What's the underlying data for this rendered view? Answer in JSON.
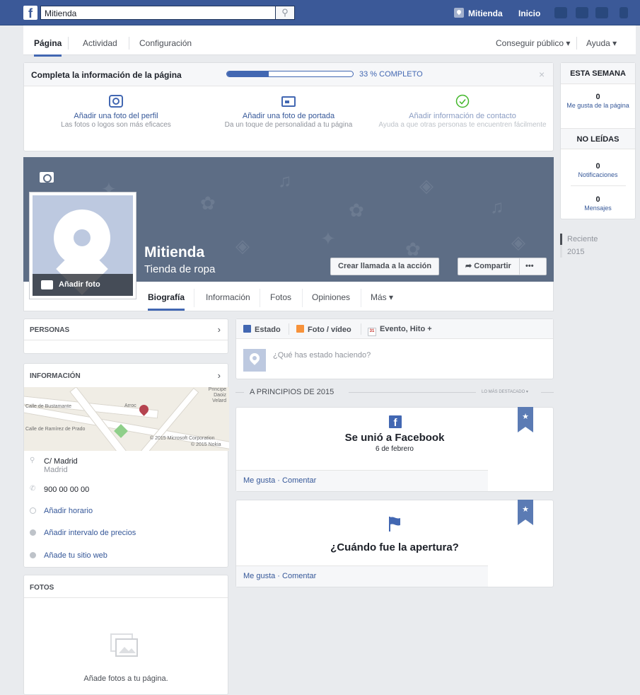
{
  "topbar": {
    "search_value": "Mitienda",
    "search_icon": "magnifier-icon",
    "profile_name": "Mitienda",
    "home_label": "Inicio"
  },
  "page_tabs": {
    "pagina": "Página",
    "actividad": "Actividad",
    "configuracion": "Configuración",
    "publico": "Conseguir público ▾",
    "ayuda": "Ayuda ▾"
  },
  "completion": {
    "title": "Completa la información de la página",
    "progress_pct": 33,
    "progress_label": "33 % COMPLETO",
    "close": "×",
    "steps": [
      {
        "title": "Añadir una foto del perfil",
        "subtitle": "Las fotos o logos son más eficaces"
      },
      {
        "title": "Añadir una foto de portada",
        "subtitle": "Da un toque de personalidad a tu página"
      },
      {
        "title": "Añadir información de contacto",
        "subtitle": "Ayuda a que otras personas te encuentren fácilmente"
      }
    ]
  },
  "cover": {
    "page_name": "Mitienda",
    "category": "Tienda de ropa",
    "add_photo": "Añadir foto",
    "cta_button": "Crear llamada a la acción",
    "share_button": "Compartir",
    "more_button": "•••"
  },
  "timeline_tabs": {
    "biografia": "Biografía",
    "informacion": "Información",
    "fotos": "Fotos",
    "opiniones": "Opiniones",
    "mas": "Más ▾"
  },
  "left": {
    "personas": "PERSONAS",
    "informacion": "INFORMACIÓN",
    "map": {
      "street1": "Calle de Bustamante",
      "street2": "Calle de Ramírez de Prado",
      "poi": "Arroc",
      "corner": "Principe\nDaoiz\nVelard",
      "copyright1": "© 2015 Microsoft Corporation",
      "copyright2": "© 2015 Nokia"
    },
    "address1": "C/ Madrid",
    "address2": "Madrid",
    "phone": "900 00 00 00",
    "add_hours": "Añadir horario",
    "add_prices": "Añadir intervalo de precios",
    "add_website": "Añade tu sitio web",
    "fotos": "FOTOS",
    "fotos_empty": "Añade fotos a tu página."
  },
  "composer": {
    "tab_estado": "Estado",
    "tab_foto": "Foto / vídeo",
    "tab_evento": "Evento, Hito +",
    "calendar_day": "31",
    "placeholder": "¿Qué has estado haciendo?"
  },
  "timeline": {
    "section": "A PRINCIPIOS DE 2015",
    "highlights": "LO MÁS DESTACADO ▾"
  },
  "stories": [
    {
      "title": "Se unió a Facebook",
      "date": "6 de febrero",
      "actions": "Me gusta · Comentar"
    },
    {
      "title": "¿Cuándo fue la apertura?",
      "actions": "Me gusta · Comentar"
    }
  ],
  "right": {
    "esta_semana": "ESTA SEMANA",
    "likes_count": "0",
    "likes_label": "Me gusta de la página",
    "no_leidas": "NO LEÍDAS",
    "notif_count": "0",
    "notif_label": "Notificaciones",
    "msg_count": "0",
    "msg_label": "Mensajes",
    "years": [
      "Reciente",
      "2015"
    ]
  },
  "colors": {
    "facebook_blue": "#3b5998",
    "link_blue": "#365899",
    "accent": "#4267b2",
    "cover": "#5d6d85",
    "ok_green": "#42b72a"
  }
}
